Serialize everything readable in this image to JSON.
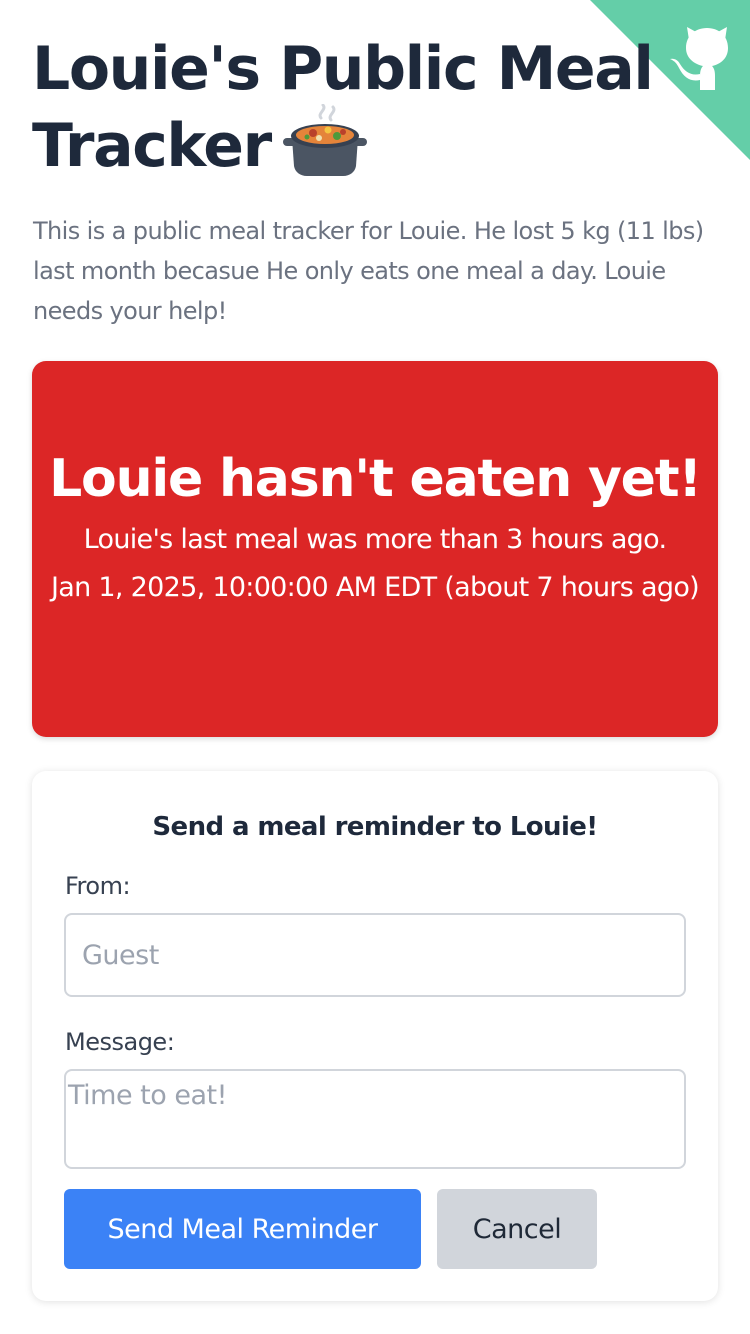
{
  "header": {
    "title": "Louie's Public Meal Tracker",
    "title_emoji_icon": "cooking-pot-icon",
    "corner_link_icon": "github-octocat-icon",
    "corner_color": "#64cea8"
  },
  "intro": {
    "text": "This is a public meal tracker for Louie. He lost 5 kg (11 lbs) last month becasue He only eats one meal a day. Louie needs your help!"
  },
  "status": {
    "title": "Louie hasn't eaten yet!",
    "subtitle": "Louie's last meal was more than 3 hours ago.",
    "last_meal_time": "Jan 1, 2025, 10:00:00 AM EDT (about 7 hours ago)",
    "color": "#dc2626"
  },
  "reminder_form": {
    "title": "Send a meal reminder to Louie!",
    "from_label": "From:",
    "from_placeholder": "Guest",
    "from_value": "",
    "message_label": "Message:",
    "message_placeholder": "Time to eat!",
    "message_value": "",
    "send_label": "Send Meal Reminder",
    "cancel_label": "Cancel",
    "send_color": "#3b82f6",
    "cancel_color": "#d1d5db"
  }
}
